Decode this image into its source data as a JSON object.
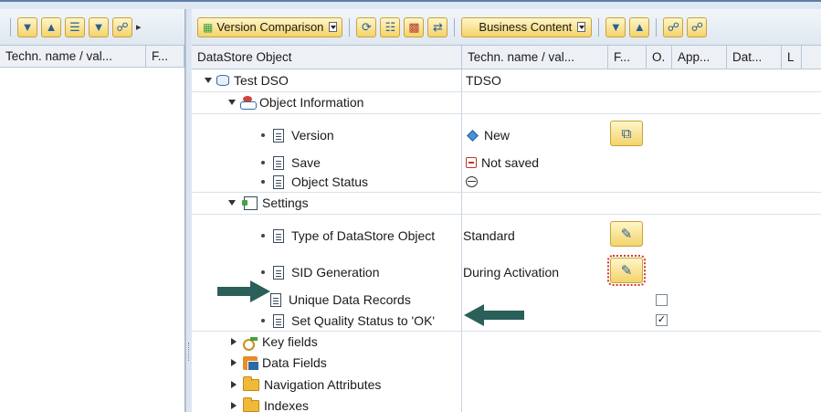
{
  "left_pane": {
    "columns": [
      "Techn. name / val...",
      "F..."
    ]
  },
  "toolbar": {
    "version_comparison_label": "Version Comparison",
    "business_content_label": "Business Content"
  },
  "header": {
    "columns": [
      "DataStore Object",
      "Techn. name / val...",
      "F...",
      "O.",
      "App...",
      "Dat...",
      "L"
    ]
  },
  "tree": {
    "root": {
      "label": "Test DSO",
      "value": "TDSO"
    },
    "object_information": {
      "label": "Object Information"
    },
    "version": {
      "label": "Version",
      "value": "New"
    },
    "save": {
      "label": "Save",
      "value": "Not saved"
    },
    "object_status": {
      "label": "Object Status"
    },
    "settings": {
      "label": "Settings"
    },
    "type_of_dso": {
      "label": "Type of DataStore Object",
      "value": "Standard"
    },
    "sid_generation": {
      "label": "SID Generation",
      "value": "During Activation"
    },
    "unique_data_records": {
      "label": "Unique Data Records",
      "checked": false
    },
    "set_quality_status": {
      "label": "Set Quality Status to 'OK'",
      "checked": true
    },
    "key_fields": {
      "label": "Key fields"
    },
    "data_fields": {
      "label": "Data Fields"
    },
    "navigation_attributes": {
      "label": "Navigation Attributes"
    },
    "indexes": {
      "label": "Indexes"
    }
  },
  "colors": {
    "button_fill": "#f4d36a",
    "header_bg": "#edf1f6",
    "toolbar_bg": "#dfe7f0",
    "arrow": "#2a5f5a"
  }
}
